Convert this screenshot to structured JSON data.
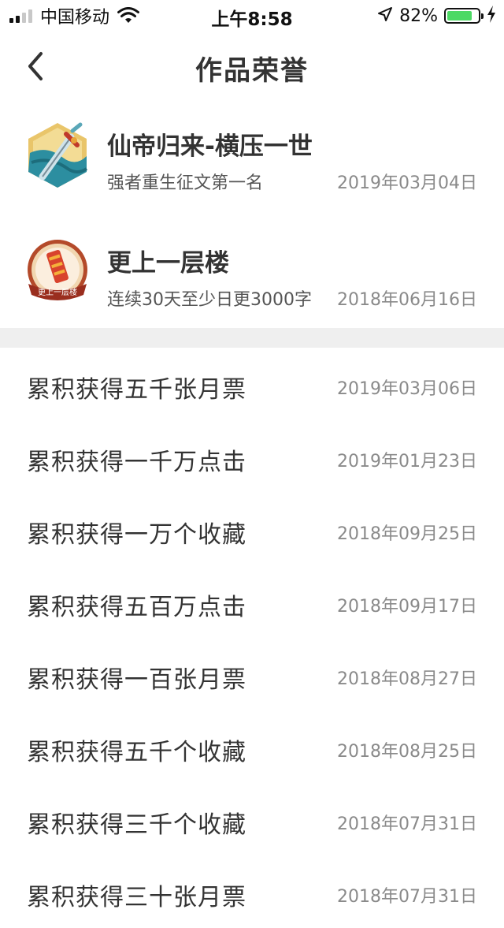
{
  "status_bar": {
    "carrier": "中国移动",
    "time": "上午8:58",
    "battery_percent": "82%",
    "battery_level": 0.82,
    "signal_bars_filled": 2,
    "signal_bars_total": 4
  },
  "nav": {
    "title": "作品荣誉",
    "back_icon": "chevron-left-icon"
  },
  "honors": [
    {
      "name": "仙帝归来-横压一世",
      "desc": "强者重生征文第一名",
      "date": "2019年03月04日",
      "icon": "sword-badge-icon"
    },
    {
      "name": "更上一层楼",
      "desc": "连续30天至少日更3000字",
      "date": "2018年06月16日",
      "icon": "tower-medal-icon",
      "icon_text": "更上一层楼"
    }
  ],
  "achievements": [
    {
      "title": "累积获得五千张月票",
      "date": "2019年03月06日"
    },
    {
      "title": "累积获得一千万点击",
      "date": "2019年01月23日"
    },
    {
      "title": "累积获得一万个收藏",
      "date": "2018年09月25日"
    },
    {
      "title": "累积获得五百万点击",
      "date": "2018年09月17日"
    },
    {
      "title": "累积获得一百张月票",
      "date": "2018年08月27日"
    },
    {
      "title": "累积获得五千个收藏",
      "date": "2018年08月25日"
    },
    {
      "title": "累积获得三千个收藏",
      "date": "2018年07月31日"
    },
    {
      "title": "累积获得三十张月票",
      "date": "2018年07月31日"
    }
  ],
  "colors": {
    "battery_green": "#4cd964",
    "divider": "#efefef",
    "date_gray": "#8a8a8a"
  }
}
